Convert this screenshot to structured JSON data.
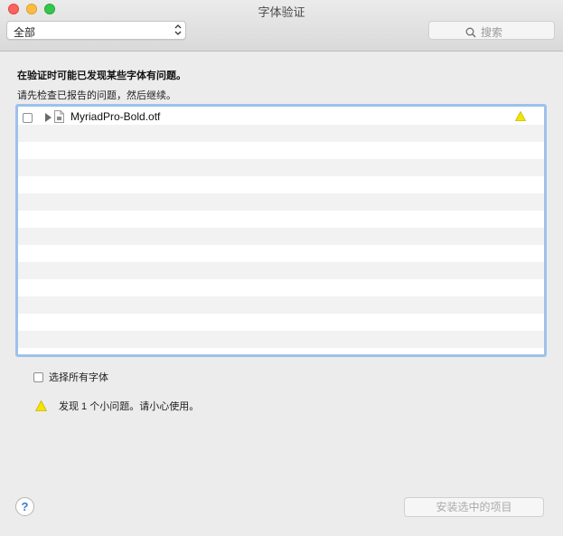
{
  "window": {
    "title": "字体验证"
  },
  "toolbar": {
    "filter_popup": {
      "selected": "全部"
    },
    "search": {
      "placeholder": "搜索",
      "icon": "search-icon"
    }
  },
  "messages": {
    "heading": "在验证时可能已发现某些字体有问题。",
    "instruction": "请先检查已报告的问题，然后继续。"
  },
  "font_list": {
    "items": [
      {
        "name": "MyriadPro-Bold.otf",
        "checked": false,
        "status": "warning"
      }
    ]
  },
  "select_all": {
    "label": "选择所有字体",
    "checked": false
  },
  "summary": {
    "text": "发现 1 个小问题。请小心使用。",
    "icon": "warning-icon"
  },
  "buttons": {
    "help": "?",
    "install": "安装选中的项目"
  },
  "colors": {
    "focus_ring": "#9ec1ea",
    "warning": "#f5e400",
    "close": "#fc615d",
    "minimize": "#fdbc40",
    "zoom": "#34c84a"
  }
}
